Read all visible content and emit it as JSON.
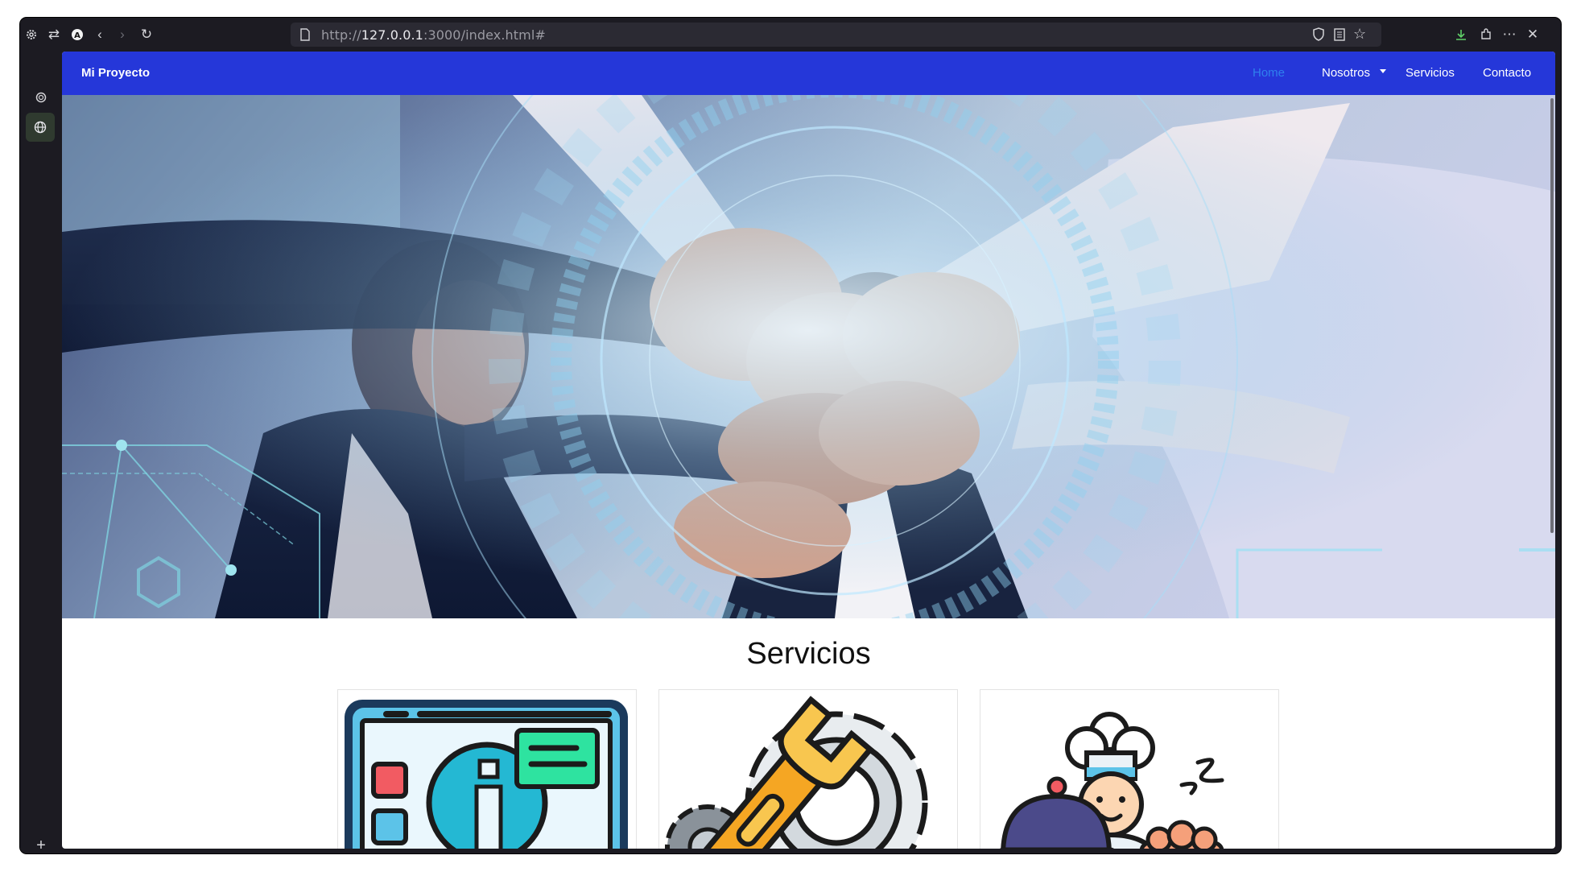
{
  "browser": {
    "url_prefix": "http://",
    "url_host": "127.0.0.1",
    "url_rest": ":3000/index.html#",
    "icons": [
      "settings-icon",
      "sync-icon",
      "account-icon",
      "back-icon",
      "forward-icon",
      "reload-icon",
      "page-icon",
      "shield-icon",
      "reader-icon",
      "bookmark-star-icon",
      "download-icon",
      "extensions-icon",
      "menu-icon",
      "close-icon"
    ],
    "sidebar_icons": [
      "ai-chat-icon",
      "web-icon",
      "add-icon"
    ]
  },
  "site": {
    "brand": "Mi Proyecto",
    "nav": [
      {
        "label": "Home",
        "active": true
      },
      {
        "label": "Nosotros",
        "dropdown": true
      },
      {
        "label": "Servicios"
      },
      {
        "label": "Contacto"
      }
    ],
    "colors": {
      "navbar": "#2537d9",
      "active_link": "#2f80ed"
    },
    "section_title": "Servicios",
    "cards": [
      {
        "icon": "information-screen-icon"
      },
      {
        "icon": "wrench-gear-icon"
      },
      {
        "icon": "chef-icon"
      }
    ]
  }
}
